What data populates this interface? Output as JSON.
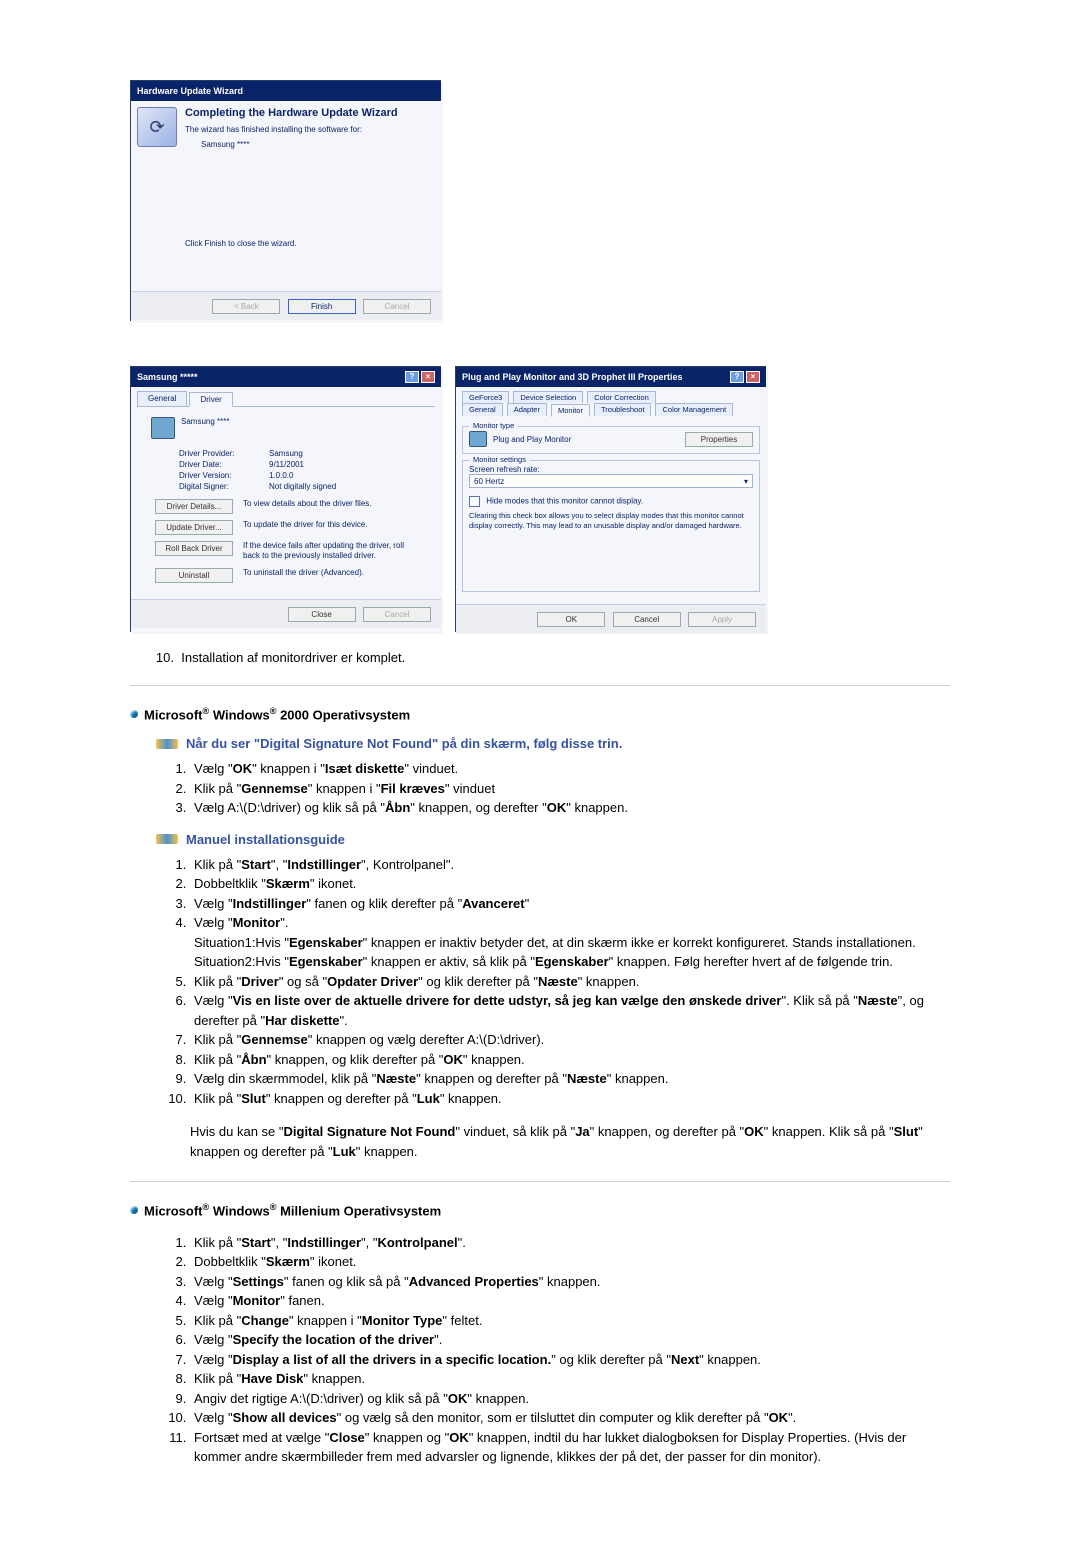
{
  "wizard": {
    "title": "Hardware Update Wizard",
    "heading": "Completing the Hardware Update Wizard",
    "line1": "The wizard has finished installing the software for:",
    "device": "Samsung ****",
    "line2": "Click Finish to close the wizard.",
    "btn_back": "< Back",
    "btn_finish": "Finish",
    "btn_cancel": "Cancel"
  },
  "driver": {
    "title": "Samsung *****",
    "tab_general": "General",
    "tab_driver": "Driver",
    "device": "Samsung ****",
    "rows": {
      "provider_k": "Driver Provider:",
      "provider_v": "Samsung",
      "date_k": "Driver Date:",
      "date_v": "9/11/2001",
      "version_k": "Driver Version:",
      "version_v": "1.0.0.0",
      "signer_k": "Digital Signer:",
      "signer_v": "Not digitally signed"
    },
    "btns": {
      "details": "Driver Details...",
      "details_d": "To view details about the driver files.",
      "update": "Update Driver...",
      "update_d": "To update the driver for this device.",
      "rollback": "Roll Back Driver",
      "rollback_d": "If the device fails after updating the driver, roll back to the previously installed driver.",
      "uninstall": "Uninstall",
      "uninstall_d": "To uninstall the driver (Advanced).",
      "close": "Close",
      "cancel": "Cancel"
    }
  },
  "prop": {
    "title": "Plug and Play Monitor and 3D Prophet III Properties",
    "tabs_top": [
      "GeForce3",
      "Device Selection",
      "Color Correction"
    ],
    "tabs_bot": [
      "General",
      "Adapter",
      "Monitor",
      "Troubleshoot",
      "Color Management"
    ],
    "monitor_type_legend": "Monitor type",
    "monitor_name": "Plug and Play Monitor",
    "properties_btn": "Properties",
    "monitor_settings_legend": "Monitor settings",
    "refresh_label": "Screen refresh rate:",
    "refresh_value": "60 Hertz",
    "hide_label": "Hide modes that this monitor cannot display.",
    "hide_note": "Clearing this check box allows you to select display modes that this monitor cannot display correctly. This may lead to an unusable display and/or damaged hardware.",
    "ok": "OK",
    "cancel": "Cancel",
    "apply": "Apply"
  },
  "step10": "Installation af monitordriver er komplet.",
  "win2000": {
    "title_prefix": "Microsoft",
    "title_mid": " Windows",
    "title_suffix": " 2000 Operativsystem",
    "sub1": "Når du ser \"Digital Signature Not Found\" på din skærm, følg disse trin.",
    "list1": {
      "1": "Vælg \"OK\" knappen i \"Isæt diskette\" vinduet.",
      "2": "Klik på \"Gennemse\" knappen i \"Fil kræves\" vinduet",
      "3": "Vælg A:\\(D:\\driver) og klik så på \"Åbn\" knappen, og derefter \"OK\" knappen."
    },
    "sub2": "Manuel installationsguide",
    "list2": {
      "1": "Klik på \"Start\", \"Indstillinger\", Kontrolpanel\".",
      "2": "Dobbeltklik \"Skærm\" ikonet.",
      "3": "Vælg \"Indstillinger\" fanen og klik derefter på \"Avanceret\"",
      "4": "Vælg \"Monitor\".",
      "4a": "Situation1:Hvis \"Egenskaber\" knappen er inaktiv betyder det, at din skærm ikke er korrekt konfigureret. Stands installationen.",
      "4b": "Situation2:Hvis \"Egenskaber\" knappen er aktiv, så klik på \"Egenskaber\" knappen. Følg herefter hvert af de følgende trin.",
      "5": "Klik på \"Driver\" og så \"Opdater Driver\" og klik derefter på \"Næste\" knappen.",
      "6": "Vælg \"Vis en liste over de aktuelle drivere for dette udstyr, så jeg kan vælge den ønskede driver\". Klik så på \"Næste\", og derefter på \"Har diskette\".",
      "7": "Klik på \"Gennemse\" knappen og vælg derefter A:\\(D:\\driver).",
      "8": "Klik på \"Åbn\" knappen, og klik derefter på \"OK\" knappen.",
      "9": "Vælg din skærmmodel, klik på \"Næste\" knappen og derefter på \"Næste\" knappen.",
      "10": "Klik på \"Slut\" knappen og derefter på \"Luk\" knappen."
    },
    "note": "Hvis du kan se \"Digital Signature Not Found\" vinduet, så klik på \"Ja\" knappen, og derefter på \"OK\" knappen. Klik så på \"Slut\" knappen og derefter på \"Luk\" knappen."
  },
  "winme": {
    "title_prefix": "Microsoft",
    "title_mid": " Windows",
    "title_suffix": " Millenium Operativsystem",
    "list": {
      "1": "Klik på \"Start\", \"Indstillinger\", \"Kontrolpanel\".",
      "2": "Dobbeltklik \"Skærm\" ikonet.",
      "3": "Vælg \"Settings\" fanen og klik så på \"Advanced Properties\" knappen.",
      "4": "Vælg \"Monitor\" fanen.",
      "5": "Klik på \"Change\" knappen i \"Monitor Type\" feltet.",
      "6": "Vælg \"Specify the location of the driver\".",
      "7": "Vælg \"Display a list of all the drivers in a specific location.\" og klik derefter på \"Next\" knappen.",
      "8": "Klik på \"Have Disk\" knappen.",
      "9": "Angiv det rigtige A:\\(D:\\driver) og klik så på \"OK\" knappen.",
      "10": "Vælg \"Show all devices\" og vælg så den monitor, som er tilsluttet din computer og klik derefter på \"OK\".",
      "11": "Fortsæt med at vælge \"Close\" knappen og \"OK\" knappen, indtil du har lukket dialogboksen for Display Properties. (Hvis der kommer andre skærmbilleder frem med advarsler og lignende, klikkes der på det, der passer for din monitor)."
    }
  }
}
